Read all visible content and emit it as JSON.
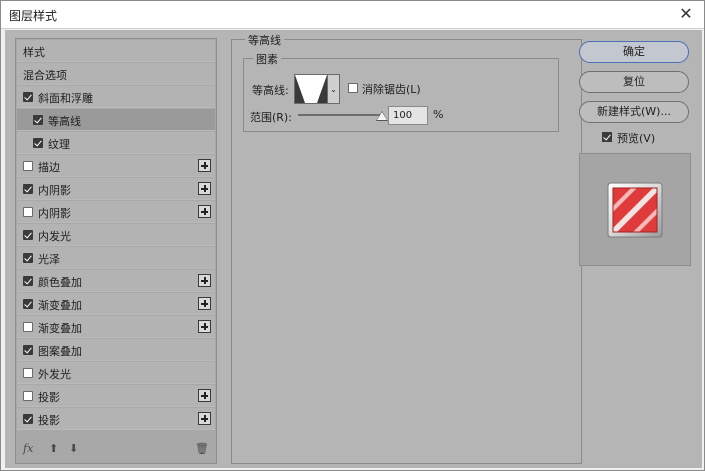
{
  "window": {
    "title": "图层样式",
    "close_icon": "close-icon"
  },
  "styles_list": {
    "header": "样式",
    "blend_options": "混合选项",
    "items": [
      {
        "label": "斜面和浮雕",
        "checked": true,
        "plus": false,
        "indent": 0,
        "selected": false
      },
      {
        "label": "等高线",
        "checked": true,
        "plus": false,
        "indent": 1,
        "selected": true
      },
      {
        "label": "纹理",
        "checked": true,
        "plus": false,
        "indent": 1,
        "selected": false
      },
      {
        "label": "描边",
        "checked": false,
        "plus": true,
        "indent": 0,
        "selected": false
      },
      {
        "label": "内阴影",
        "checked": true,
        "plus": true,
        "indent": 0,
        "selected": false
      },
      {
        "label": "内阴影",
        "checked": false,
        "plus": true,
        "indent": 0,
        "selected": false
      },
      {
        "label": "内发光",
        "checked": true,
        "plus": false,
        "indent": 0,
        "selected": false
      },
      {
        "label": "光泽",
        "checked": true,
        "plus": false,
        "indent": 0,
        "selected": false
      },
      {
        "label": "颜色叠加",
        "checked": true,
        "plus": true,
        "indent": 0,
        "selected": false
      },
      {
        "label": "渐变叠加",
        "checked": true,
        "plus": true,
        "indent": 0,
        "selected": false
      },
      {
        "label": "渐变叠加",
        "checked": false,
        "plus": true,
        "indent": 0,
        "selected": false
      },
      {
        "label": "图案叠加",
        "checked": true,
        "plus": false,
        "indent": 0,
        "selected": false
      },
      {
        "label": "外发光",
        "checked": false,
        "plus": false,
        "indent": 0,
        "selected": false
      },
      {
        "label": "投影",
        "checked": false,
        "plus": true,
        "indent": 0,
        "selected": false
      },
      {
        "label": "投影",
        "checked": true,
        "plus": true,
        "indent": 0,
        "selected": false
      }
    ],
    "footer": {
      "fx": "fx",
      "up": "⬆",
      "down": "⬇",
      "trash": "🗑"
    }
  },
  "contour_panel": {
    "group_title": "等高线",
    "subgroup_title": "图素",
    "contour_label": "等高线:",
    "anti_alias_label": "消除锯齿(L)",
    "anti_alias_checked": false,
    "range_label": "范围(R):",
    "range_value": "100",
    "range_unit": "%"
  },
  "buttons": {
    "ok": "确定",
    "reset": "复位",
    "new_style": "新建样式(W)...",
    "preview_label": "预览(V)",
    "preview_checked": true
  },
  "colors": {
    "accent_border": "#4a6fb5",
    "preview_red": "#e03b3b"
  }
}
